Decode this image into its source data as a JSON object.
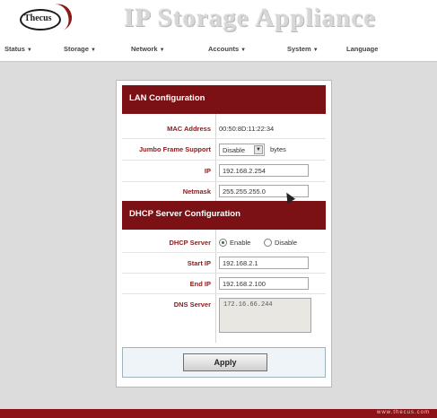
{
  "header": {
    "logo_text": "Thecus",
    "app_title": "IP Storage Appliance"
  },
  "nav": {
    "items": [
      {
        "label": "Status",
        "has_menu": true
      },
      {
        "label": "Storage",
        "has_menu": true
      },
      {
        "label": "Network",
        "has_menu": true
      },
      {
        "label": "Accounts",
        "has_menu": true
      },
      {
        "label": "System",
        "has_menu": true
      },
      {
        "label": "Language",
        "has_menu": false
      }
    ],
    "caret": "▼"
  },
  "lan": {
    "title": "LAN Configuration",
    "mac_label": "MAC Address",
    "mac_value": "00:50:8D:11:22:34",
    "jumbo_label": "Jumbo Frame Support",
    "jumbo_value": "Disable",
    "jumbo_unit": "bytes",
    "ip_label": "IP",
    "ip_value": "192.168.2.254",
    "netmask_label": "Netmask",
    "netmask_value": "255.255.255.0"
  },
  "dhcp": {
    "title": "DHCP Server Configuration",
    "server_label": "DHCP Server",
    "enable_label": "Enable",
    "disable_label": "Disable",
    "selected": "Enable",
    "start_label": "Start IP",
    "start_value": "192.168.2.1",
    "end_label": "End IP",
    "end_value": "192.168.2.100",
    "dns_label": "DNS Server",
    "dns_value": "172.16.66.244"
  },
  "actions": {
    "apply_label": "Apply"
  },
  "footer": {
    "url": "www.thecus.com"
  },
  "colors": {
    "brand_red": "#7b1115",
    "label_red": "#8b1a1a",
    "content_bg": "#dcdcdc"
  }
}
